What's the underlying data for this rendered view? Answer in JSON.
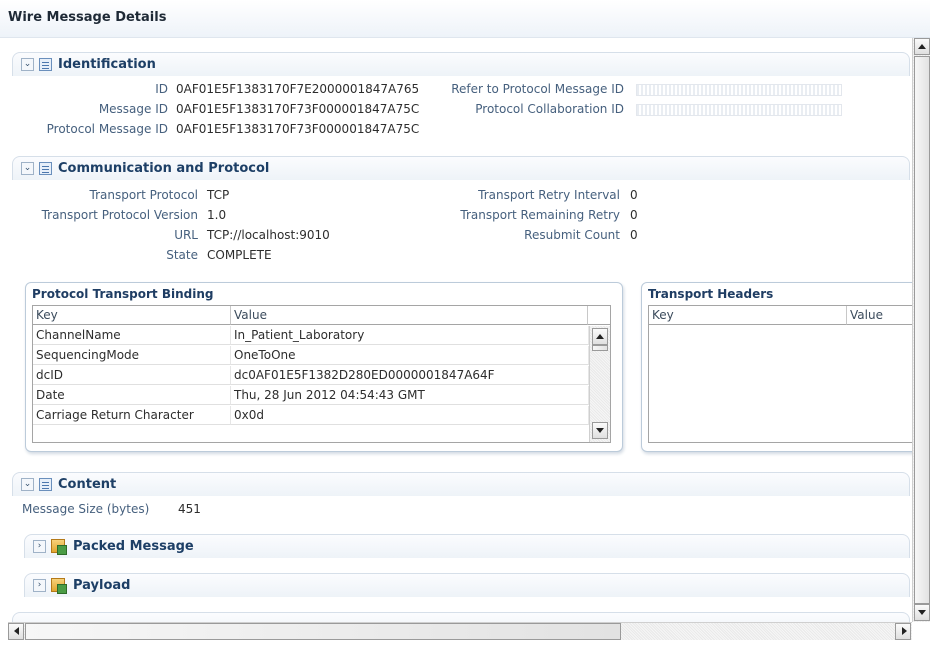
{
  "window": {
    "title": "Wire Message Details"
  },
  "identification": {
    "title": "Identification",
    "fields": [
      {
        "label": "ID",
        "value": "0AF01E5F1383170F7E2000001847A765"
      },
      {
        "label": "Message ID",
        "value": "0AF01E5F1383170F73F000001847A75C"
      },
      {
        "label": "Protocol Message ID",
        "value": "0AF01E5F1383170F73F000001847A75C"
      }
    ],
    "right_fields": [
      {
        "label": "Refer to Protocol Message ID"
      },
      {
        "label": "Protocol Collaboration ID"
      }
    ]
  },
  "communication": {
    "title": "Communication and Protocol",
    "fields": [
      {
        "label": "Transport Protocol",
        "value": "TCP"
      },
      {
        "label": "Transport Protocol Version",
        "value": "1.0"
      },
      {
        "label": "URL",
        "value": "TCP://localhost:9010"
      },
      {
        "label": "State",
        "value": "COMPLETE"
      }
    ],
    "right_fields": [
      {
        "label": "Transport Retry Interval",
        "value": "0"
      },
      {
        "label": "Transport Remaining Retry",
        "value": "0"
      },
      {
        "label": "Resubmit Count",
        "value": "0"
      }
    ]
  },
  "binding": {
    "title": "Protocol Transport Binding",
    "columns": [
      "Key",
      "Value"
    ],
    "rows": [
      [
        "ChannelName",
        "In_Patient_Laboratory"
      ],
      [
        "SequencingMode",
        "OneToOne"
      ],
      [
        "dcID",
        "dc0AF01E5F1382D280ED0000001847A64F"
      ],
      [
        "Date",
        "Thu, 28 Jun 2012 04:54:43 GMT"
      ],
      [
        "Carriage Return Character",
        "0x0d"
      ]
    ]
  },
  "headers": {
    "title": "Transport Headers",
    "columns": [
      "Key",
      "Value"
    ]
  },
  "content": {
    "title": "Content",
    "size_label": "Message Size (bytes)",
    "size_value": "451",
    "subsections": [
      {
        "title": "Packed Message"
      },
      {
        "title": "Payload"
      }
    ]
  },
  "icons": {
    "collapse": "chevron-down-icon",
    "expand": "chevron-right-icon",
    "section": "list-icon",
    "package": "package-icon"
  },
  "colors": {
    "header_text": "#1d3f66",
    "label_text": "#46607e"
  }
}
